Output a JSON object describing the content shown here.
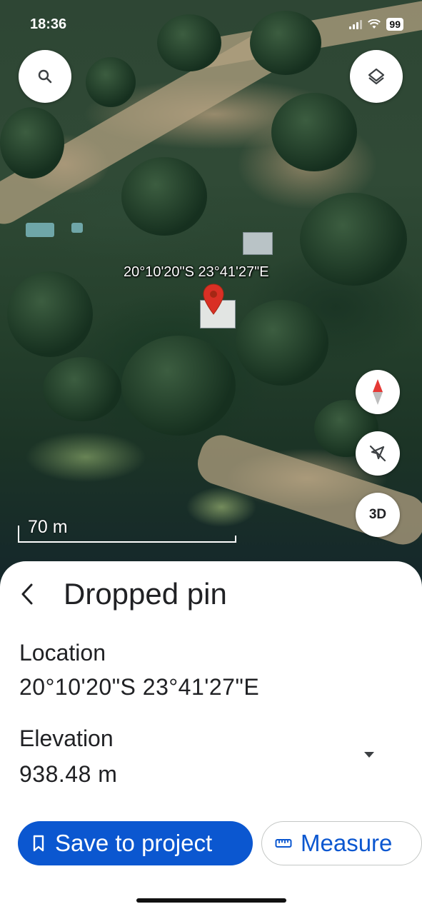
{
  "status_bar": {
    "time": "18:36",
    "battery": "99"
  },
  "map": {
    "pin_coordinates": "20°10'20\"S 23°41'27\"E",
    "scale": "70 m",
    "three_d_label": "3D"
  },
  "sheet": {
    "title": "Dropped pin",
    "location": {
      "label": "Location",
      "value": "20°10'20\"S 23°41'27\"E"
    },
    "elevation": {
      "label": "Elevation",
      "value": "938.48 m"
    },
    "save_label": "Save to project",
    "measure_label": "Measure"
  },
  "colors": {
    "primary": "#0b57d0",
    "pin": "#d93025"
  },
  "icons": [
    "search-icon",
    "layers-icon",
    "compass-icon",
    "location-off-icon",
    "back-icon",
    "dropdown-icon",
    "bookmark-icon",
    "ruler-icon"
  ]
}
